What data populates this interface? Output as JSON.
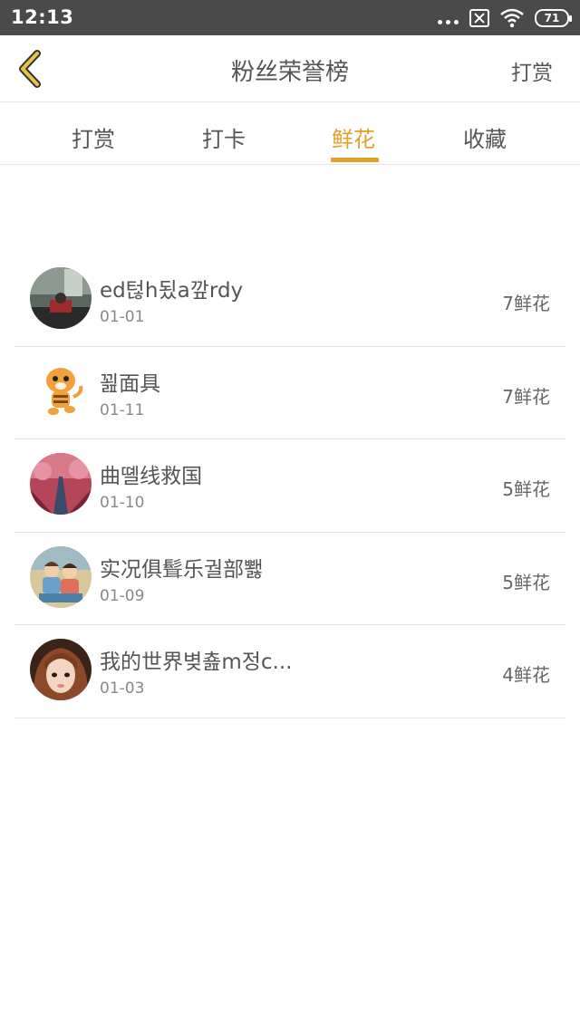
{
  "status_bar": {
    "time": "12:13",
    "battery": "71"
  },
  "header": {
    "title": "粉丝荣誉榜",
    "action": "打赏"
  },
  "tabs": [
    {
      "label": "打赏",
      "active": false
    },
    {
      "label": "打卡",
      "active": false
    },
    {
      "label": "鲜花",
      "active": true
    },
    {
      "label": "收藏",
      "active": false
    }
  ],
  "colors": {
    "accent": "#e5a126",
    "status_bar": "#4a4a4a",
    "divider": "#e6e6e6"
  },
  "list": [
    {
      "name": "ed턶h됬a깦rdy",
      "date": "01-01",
      "count": "7鲜花",
      "avatar": "avatar-photo-dark-room"
    },
    {
      "name": "꾎面具",
      "date": "01-11",
      "count": "7鲜花",
      "avatar": "avatar-cartoon-tiger"
    },
    {
      "name": "曲뗼线救国",
      "date": "01-10",
      "count": "5鲜花",
      "avatar": "avatar-photo-pink-road"
    },
    {
      "name": "实况俱髶乐궐部뾇",
      "date": "01-09",
      "count": "5鲜花",
      "avatar": "avatar-photo-couple"
    },
    {
      "name": "我的世界볒춆m정c...",
      "date": "01-03",
      "count": "4鲜花",
      "avatar": "avatar-photo-girl"
    }
  ]
}
